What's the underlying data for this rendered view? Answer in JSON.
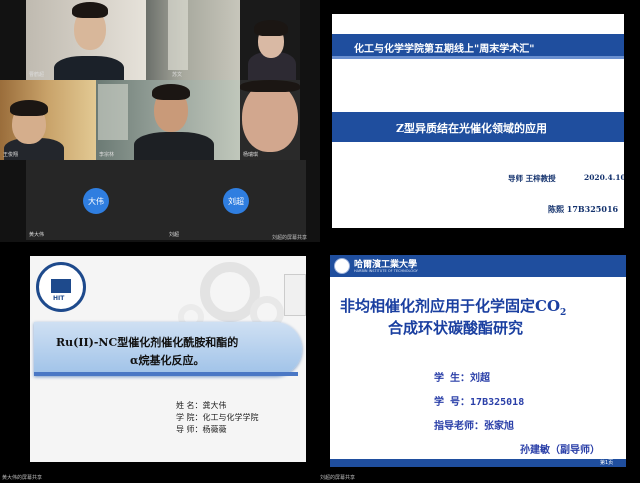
{
  "video_grid": {
    "participants": [
      {
        "name": "曹鹤超",
        "avatar_text": ""
      },
      {
        "name": "苏文",
        "avatar_text": ""
      },
      {
        "name": "王俊翔",
        "avatar_text": ""
      },
      {
        "name": "李宗林",
        "avatar_text": ""
      },
      {
        "name": "杨瑞琪",
        "avatar_text": ""
      },
      {
        "name": "黄大伟",
        "avatar_text": "大伟"
      },
      {
        "name": "刘超",
        "avatar_text": "刘超"
      }
    ],
    "screen_share_label": "刘超的屏幕共享"
  },
  "slide1": {
    "header_title": "化工与化学学院第五期线上\"周末学术汇\"",
    "topic": "Z型异质结在光催化领域的应用",
    "advisor": "导师  王梓教授",
    "date": "2020.4.10",
    "presenter": "陈熙  17B325016"
  },
  "slide2": {
    "title_line1": "Ru(II)-NC型催化剂催化酰胺和酯的",
    "title_line2": "α烷基化反应。",
    "rows": [
      {
        "label": "姓      名：",
        "value": "龚大伟"
      },
      {
        "label": "学      院：",
        "value": "化工与化学学院"
      },
      {
        "label": "导      师：",
        "value": "杨薇薇"
      }
    ],
    "logo_text": "HIT",
    "footer_label": "黄大伟的屏幕共享"
  },
  "slide3": {
    "university_cn": "哈爾濱工業大學",
    "university_en": "HARBIN INSTITUTE OF TECHNOLOGY",
    "title_line1": "非均相催化剂应用于化学固定CO",
    "title_sub": "2",
    "title_line2": "合成环状碳酸酯研究",
    "rows": [
      {
        "label": "学        生：",
        "value": "刘超"
      },
      {
        "label": "学        号：",
        "value": "17B325018"
      },
      {
        "label": "指导老师：",
        "value": "张家旭"
      }
    ],
    "extra_line": "孙建敏（副导师）",
    "page": "第1页",
    "footer_label": "刘超的屏幕共享"
  },
  "colors": {
    "banner_blue": "#1f4e9e",
    "title_blue": "#1a3fa0",
    "avatar_blue": "#2f7ee0"
  }
}
